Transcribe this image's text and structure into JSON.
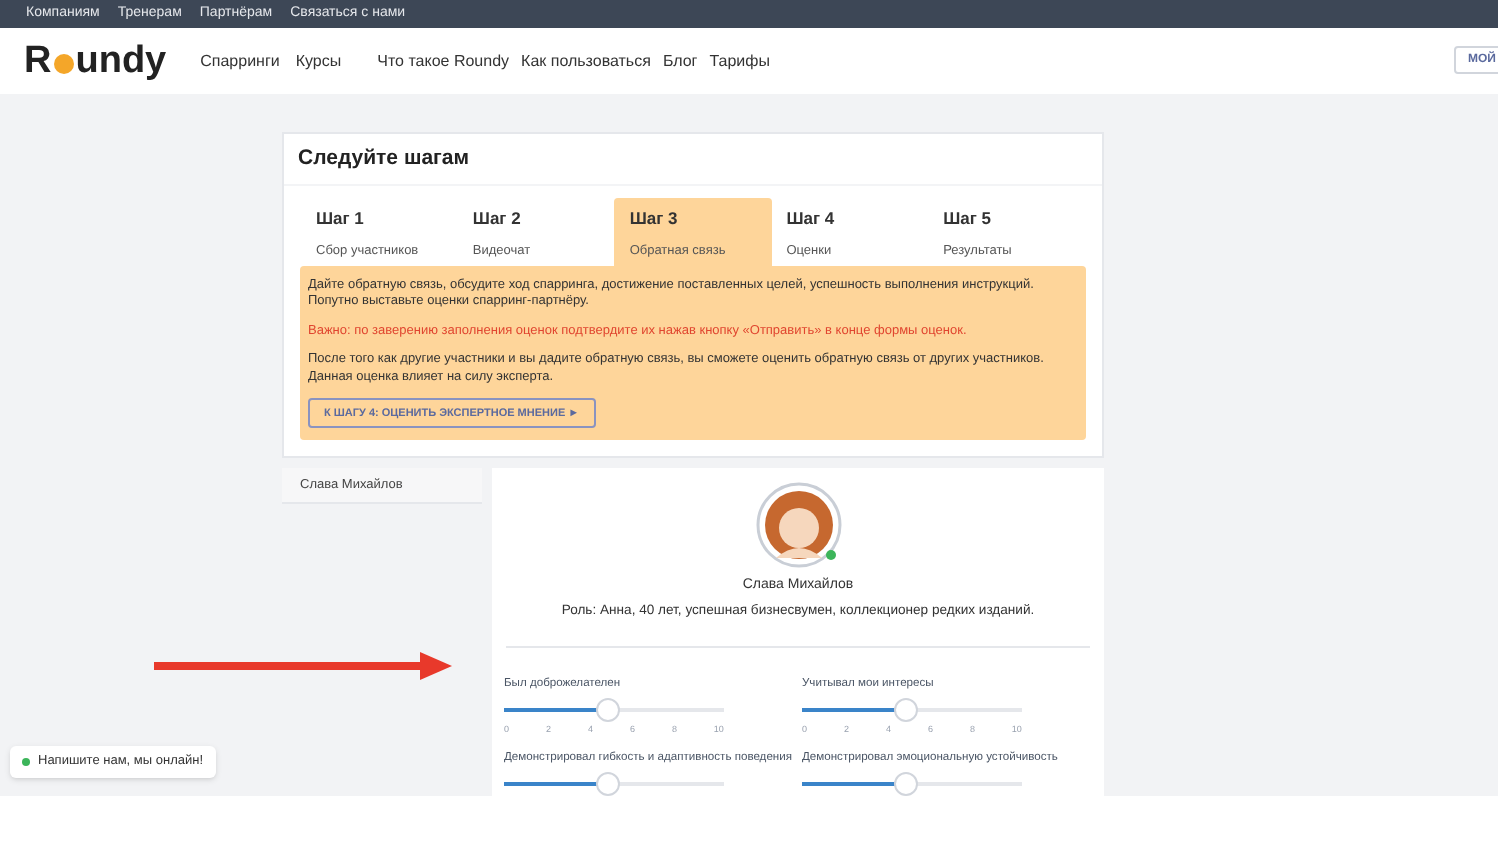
{
  "top_nav": [
    "Компаниям",
    "Тренерам",
    "Партнёрам",
    "Связаться с нами"
  ],
  "header": {
    "logo_start": "R",
    "logo_end": "undy",
    "nav_left": [
      "Спарринги",
      "Курсы"
    ],
    "nav_right": [
      "Что такое Roundy",
      "Как пользоваться",
      "Блог",
      "Тарифы"
    ],
    "account_button": "МОЙ"
  },
  "steps_card": {
    "title": "Следуйте шагам",
    "steps": [
      {
        "title": "Шаг 1",
        "subtitle": "Сбор участников",
        "selected": false
      },
      {
        "title": "Шаг 2",
        "subtitle": "Видеочат",
        "selected": false
      },
      {
        "title": "Шаг 3",
        "subtitle": "Обратная связь",
        "selected": true
      },
      {
        "title": "Шаг 4",
        "subtitle": "Оценки",
        "selected": false
      },
      {
        "title": "Шаг 5",
        "subtitle": "Результаты",
        "selected": false
      }
    ],
    "instructions": "Дайте обратную связь, обсудите ход спарринга, достижение поставленных целей, успешность выполнения инструкций. Попутно выставьте оценки спарринг-партнёру.",
    "warning": "Важно: по заверению заполнения оценок подтвердите их нажав кнопку «Отправить» в конце формы оценок.",
    "note": "После того как другие участники и вы дадите обратную связь, вы сможете оценить обратную связь от других участников. Данная оценка влияет на силу эксперта.",
    "next_button": "К ШАГУ 4: ОЦЕНИТЬ ЭКСПЕРТНОЕ МНЕНИЕ ►"
  },
  "participants": [
    {
      "name": "Слава Михайлов"
    }
  ],
  "profile": {
    "name": "Слава Михайлов",
    "online": true,
    "role": "Роль: Анна, 40 лет, успешная бизнесвумен, коллекционер редких изданий.",
    "ratings": [
      {
        "label": "Был доброжелателен",
        "level": 0.47,
        "ticks": [
          "0",
          "2",
          "4",
          "6",
          "8",
          "10"
        ]
      },
      {
        "label": "Учитывал мои интересы",
        "level": 0.47,
        "ticks": [
          "0",
          "2",
          "4",
          "6",
          "8",
          "10"
        ]
      },
      {
        "label": "Демонстрировал гибкость и адаптивность поведения",
        "level": 0.47
      },
      {
        "label": "Демонстрировал эмоциональную устойчивость",
        "level": 0.47
      }
    ]
  },
  "chat_widget": {
    "text": "Напишите нам, мы онлайн!",
    "online": true
  }
}
